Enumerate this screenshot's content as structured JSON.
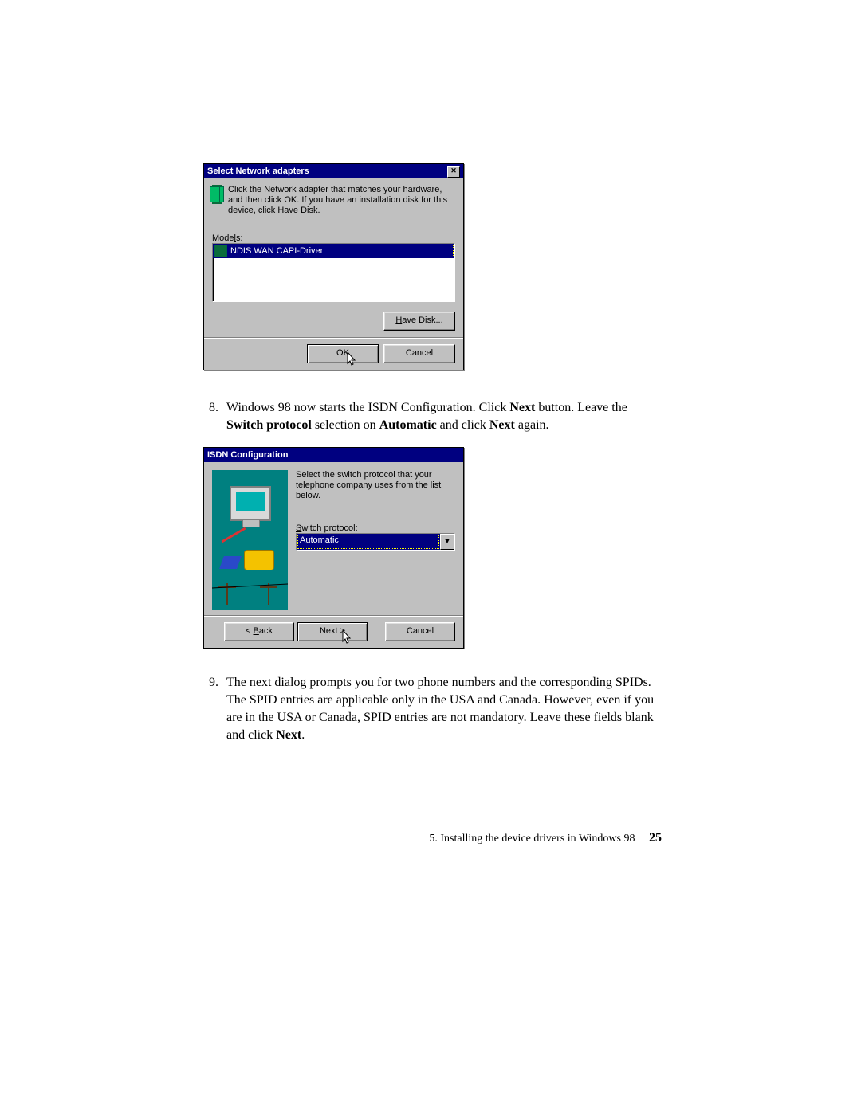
{
  "dialog1": {
    "title": "Select Network adapters",
    "hint": "Click the Network adapter that matches your hardware, and then click OK. If you have an installation disk for this device, click Have Disk.",
    "models_label": "Models:",
    "selected_model": "NDIS WAN CAPI-Driver",
    "have_disk": "Have Disk...",
    "ok": "OK",
    "cancel": "Cancel"
  },
  "step8": {
    "num": "8.",
    "t1": "Windows 98 now starts the ISDN Configuration. Click ",
    "b1": "Next",
    "t2": " button. Leave the ",
    "b2": "Switch protocol",
    "t3": " selection on ",
    "b3": "Automatic",
    "t4": " and click ",
    "b4": "Next",
    "t5": " again."
  },
  "dialog2": {
    "title": "ISDN Configuration",
    "prompt": "Select the switch protocol that your telephone company uses from the list below.",
    "sp_label": "Switch protocol:",
    "sp_value": "Automatic",
    "back": "< Back",
    "next": "Next >",
    "cancel": "Cancel"
  },
  "step9": {
    "num": "9.",
    "t1": "The next dialog prompts you for two phone numbers and the corresponding SPIDs. The SPID entries are applicable only in the USA and Canada. However, even if you are in the USA or Canada, SPID entries are not mandatory. Leave these fields blank and click ",
    "b1": "Next",
    "t2": "."
  },
  "footer": {
    "section": "5.   Installing the device drivers in Windows 98",
    "page": "25"
  }
}
